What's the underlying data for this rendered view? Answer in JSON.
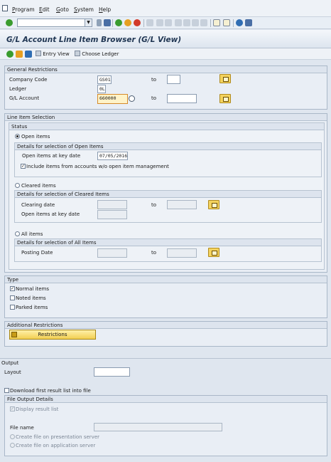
{
  "menu": {
    "items": [
      "Program",
      "Edit",
      "Goto",
      "System",
      "Help"
    ]
  },
  "title": "G/L Account Line Item Browser (G/L View)",
  "app_toolbar": {
    "entry_view": "Entry View",
    "choose_ledger": "Choose Ledger"
  },
  "general": {
    "header": "General Restrictions",
    "company_code_label": "Company Code",
    "company_code": "GS01",
    "ledger_label": "Ledger",
    "ledger": "0L",
    "gl_account_label": "G/L Account",
    "gl_account": "660000",
    "to": "to"
  },
  "lis": {
    "header": "Line Item Selection",
    "status_header": "Status",
    "open_items": "Open items",
    "open_details_header": "Details for selection of Open Items",
    "open_at_key_date_label": "Open items at key date",
    "open_at_key_date": "07/05/2016",
    "include_label": "Include items from accounts w/o open item management",
    "cleared_items": "Cleared items",
    "cleared_details_header": "Details for selection of Cleared Items",
    "clearing_date_label": "Clearing date",
    "open_at_key_date_label2": "Open items at key date",
    "all_items": "All items",
    "all_details_header": "Details for selection of All Items",
    "posting_date_label": "Posting Date",
    "to": "to"
  },
  "type": {
    "header": "Type",
    "normal": "Normal items",
    "noted": "Noted items",
    "parked": "Parked items"
  },
  "additional": {
    "header": "Additional Restrictions",
    "restrictions_button": "Restrictions"
  },
  "output": {
    "header": "Output",
    "layout_label": "Layout",
    "download_label": "Download first result list into file",
    "file_output_header": "File Output Details",
    "display_result": "Display result list",
    "file_name_label": "File name",
    "presentation": "Create file on presentation server",
    "application": "Create file on application server"
  },
  "colors": {
    "accent": "#f2cf52",
    "ok": "#3a9c2f",
    "cancel": "#d23a2a"
  }
}
